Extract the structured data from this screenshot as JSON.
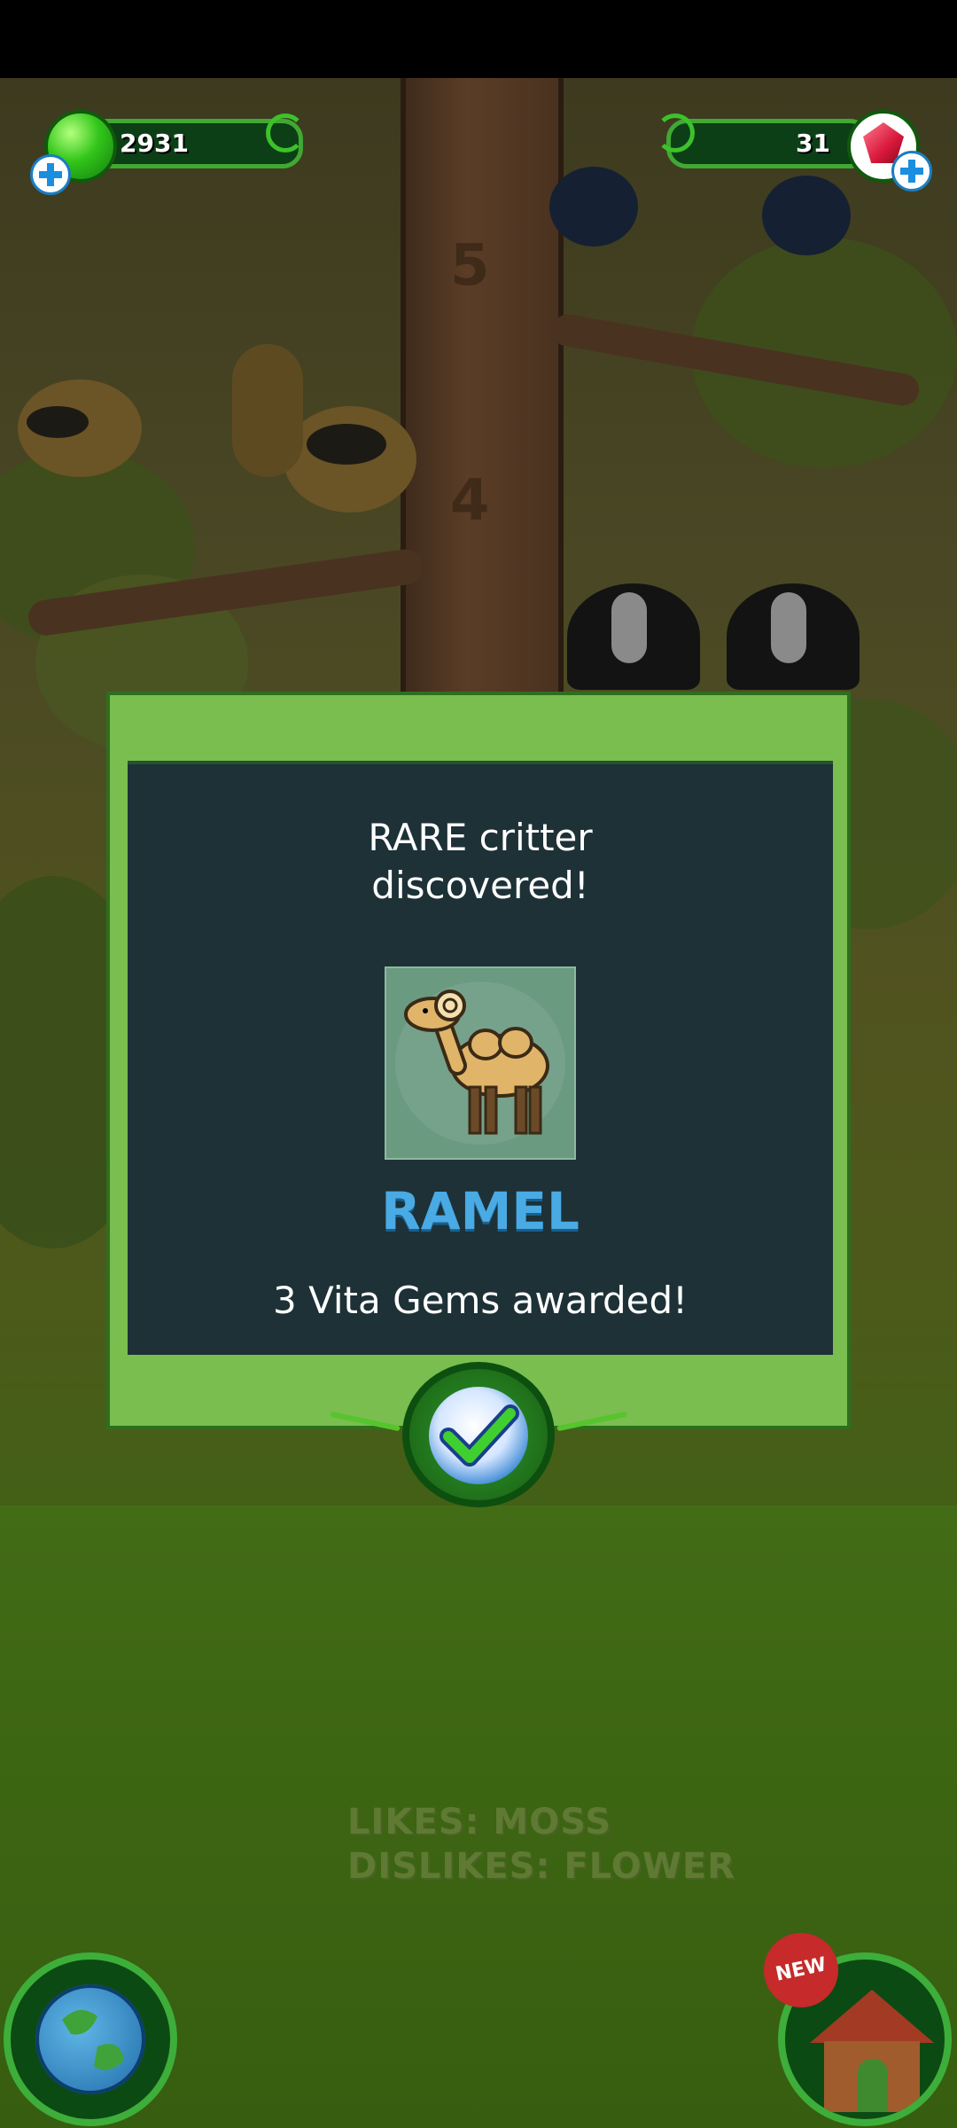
{
  "hud": {
    "green_gems": "2931",
    "vita_gems": "31",
    "green_gem_icon": "green-gem-icon",
    "red_gem_icon": "red-gem-icon",
    "add_icon": "plus-icon"
  },
  "scene": {
    "tree_number_top": "5",
    "tree_number_mid": "4"
  },
  "dialog": {
    "heading_line1": "RARE critter",
    "heading_line2": "discovered!",
    "critter_name": "RAMEL",
    "reward": "3 Vita Gems awarded!",
    "confirm_icon": "checkmark-icon"
  },
  "hint": {
    "likes": "LIKES: MOSS",
    "dislikes": "DISLIKES: FLOWER"
  },
  "bottom_nav": {
    "globe_icon": "globe-icon",
    "house_icon": "house-icon",
    "new_badge": "NEW"
  },
  "colors": {
    "dialog_frame": "#79be4f",
    "dialog_panel": "#1d3137",
    "critter_name": "#4aaae4",
    "hud_bar": "#0d3f17"
  }
}
